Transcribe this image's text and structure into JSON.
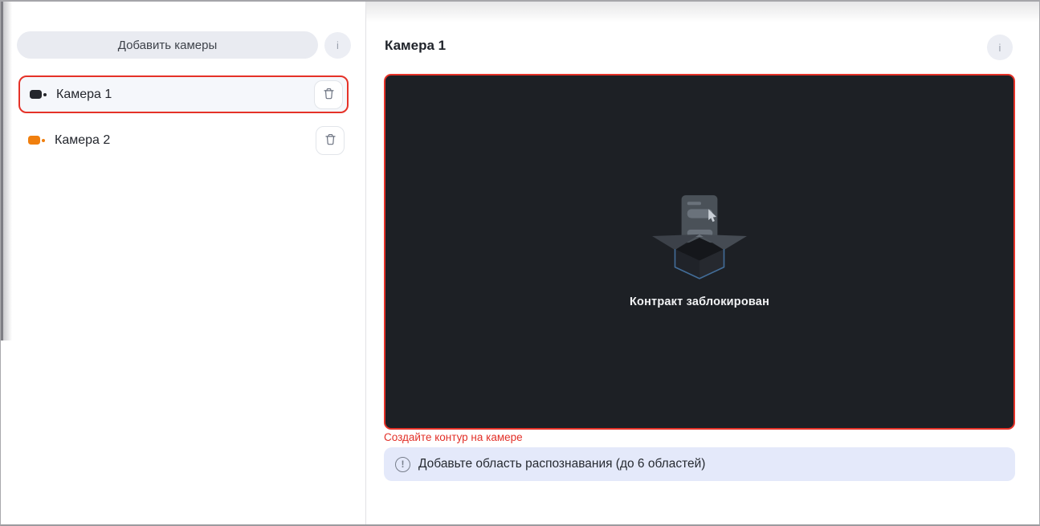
{
  "sidebar": {
    "add_button_label": "Добавить камеры",
    "info_button_label": "i",
    "cameras": [
      {
        "name": "Камера 1",
        "selected": true,
        "icon_color": "#24262b"
      },
      {
        "name": "Камера 2",
        "selected": false,
        "icon_color": "#f07f0e"
      }
    ]
  },
  "main": {
    "title": "Камера 1",
    "info_button_label": "i",
    "empty_state": {
      "message": "Контракт заблокирован"
    },
    "error_text": "Создайте контур на камере",
    "banner": {
      "icon_glyph": "!",
      "text": "Добавьте область распознавания (до 6 областей)"
    }
  },
  "colors": {
    "accent_red": "#e53228",
    "error_text_red": "#e23028",
    "selected_item_bg": "#f5f7fb",
    "button_bg": "#e9ebf1",
    "banner_bg": "#e4e9fa",
    "video_bg": "#1d2025",
    "camera2_icon_orange": "#f07f0e"
  }
}
